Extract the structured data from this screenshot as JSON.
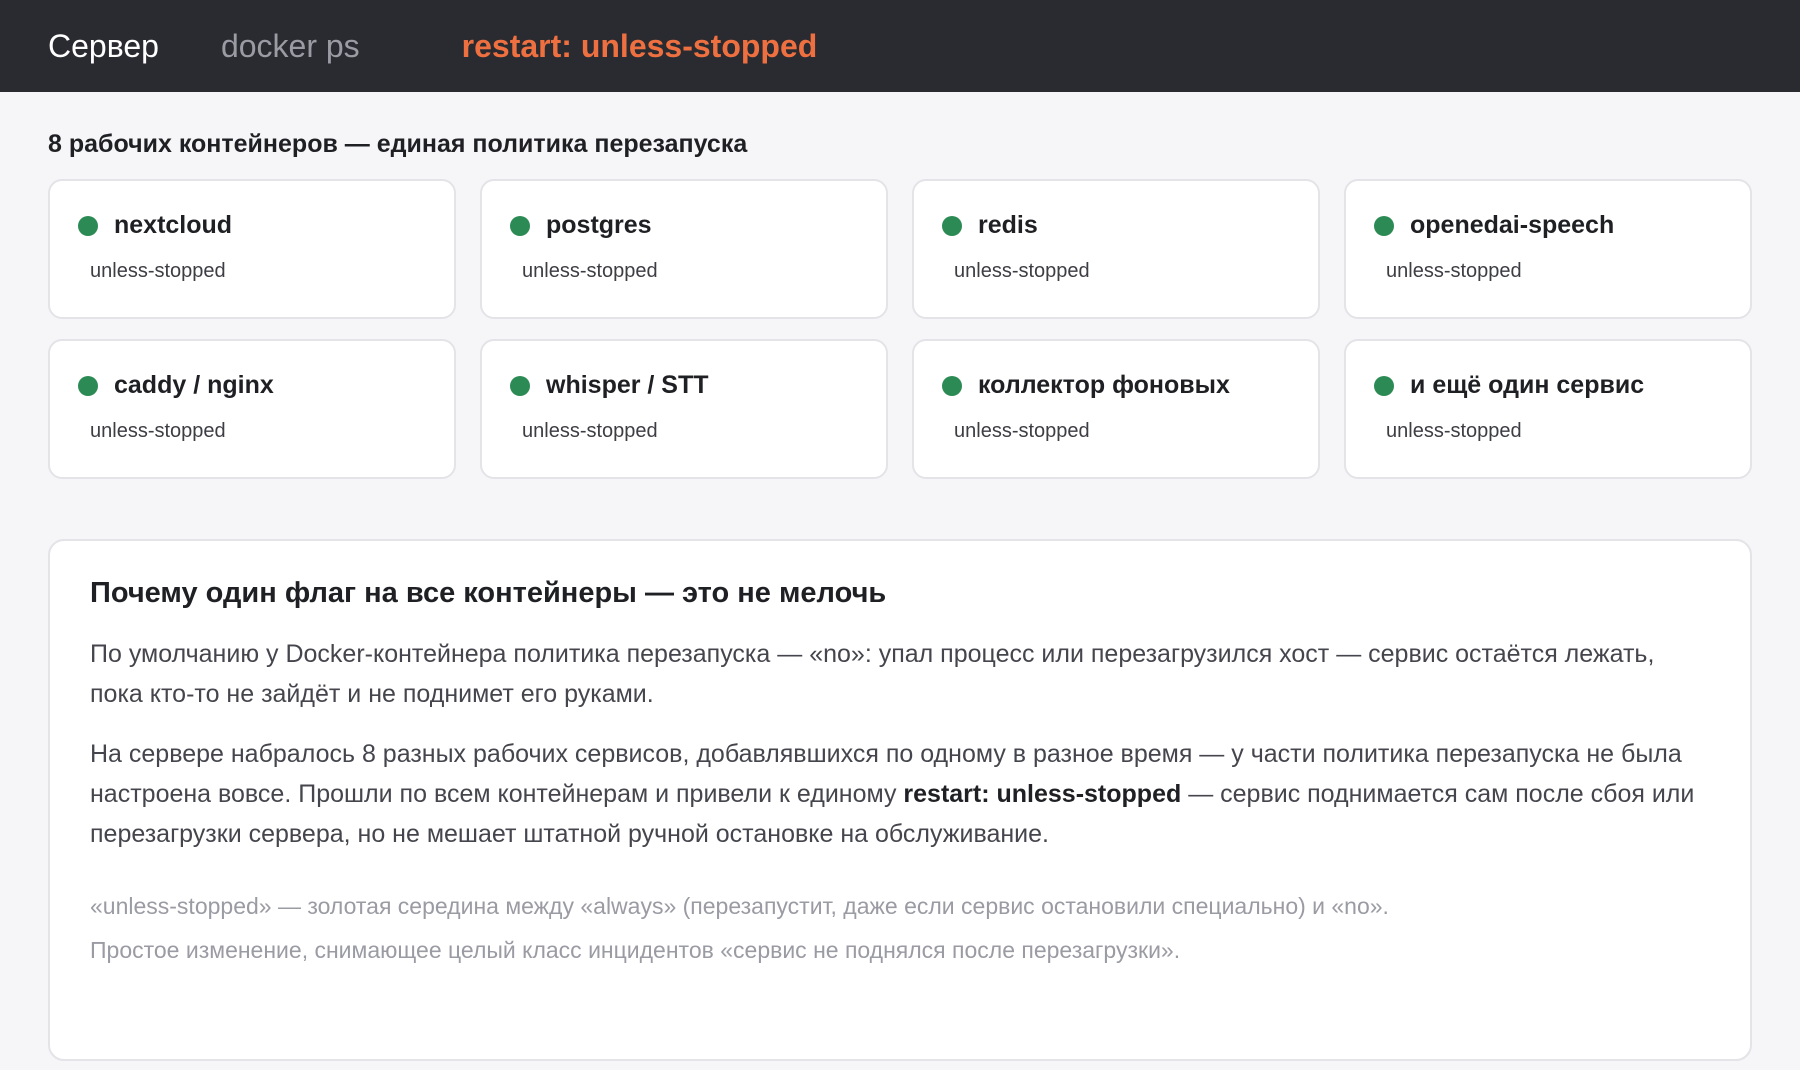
{
  "nav": {
    "server": "Сервер",
    "docker_ps": "docker ps",
    "restart": "restart: unless-stopped"
  },
  "section_title": "8 рабочих контейнеров — единая политика перезапуска",
  "containers": [
    {
      "name": "nextcloud",
      "policy": "unless-stopped"
    },
    {
      "name": "postgres",
      "policy": "unless-stopped"
    },
    {
      "name": "redis",
      "policy": "unless-stopped"
    },
    {
      "name": "openedai-speech",
      "policy": "unless-stopped"
    },
    {
      "name": "caddy / nginx",
      "policy": "unless-stopped"
    },
    {
      "name": "whisper / STT",
      "policy": "unless-stopped"
    },
    {
      "name": "коллектор фоновых",
      "policy": "unless-stopped"
    },
    {
      "name": "и ещё один сервис",
      "policy": "unless-stopped"
    }
  ],
  "colors": {
    "status_running": "#2c8a55",
    "accent": "#ee7040",
    "topbar_bg": "#2a2b31"
  },
  "panel": {
    "title": "Почему один флаг на все контейнеры — это не мелочь",
    "para1": "По умолчанию у Docker-контейнера политика перезапуска — «no»: упал процесс или перезагрузился хост — сервис остаётся лежать, пока кто-то не зайдёт и не поднимет его руками.",
    "para2_before": "На сервере набралось 8 разных рабочих сервисов, добавлявшихся по одному в разное время — у части политика перезапуска не была настроена вовсе. Прошли по всем контейнерам и привели к единому ",
    "para2_bold": "restart: unless-stopped",
    "para2_after": " — сервис поднимается сам после сбоя или перезагрузки сервера, но не мешает штатной ручной остановке на обслуживание.",
    "note1": "«unless-stopped» — золотая середина между «always» (перезапустит, даже если сервис остановили специально) и «no».",
    "note2": "Простое изменение, снимающее целый класс инцидентов «сервис не поднялся после перезагрузки»."
  }
}
